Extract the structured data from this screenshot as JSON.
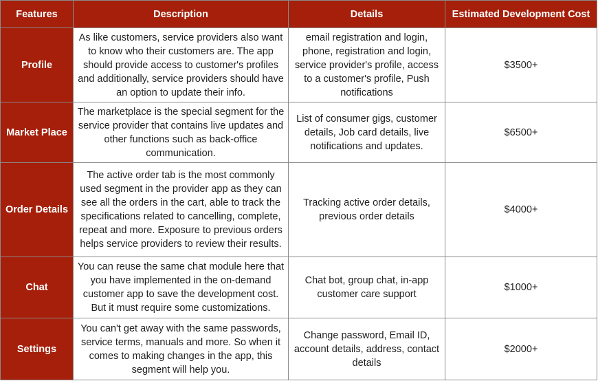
{
  "table": {
    "headers": {
      "features": "Features",
      "description": "Description",
      "details": "Details",
      "cost": "Estimated Development Cost"
    },
    "rows": [
      {
        "feature": "Profile",
        "description": "As like customers, service providers also want to know who their customers are. The app should provide access to customer's profiles and additionally, service providers should have an option to update their info.",
        "details": "email registration and login, phone, registration and login, service provider's profile, access to a customer's profile, Push notifications",
        "cost": "$3500+"
      },
      {
        "feature": "Market Place",
        "description": "The marketplace is the special segment for the service provider that contains live updates and other functions such as back-office communication.",
        "details": "List of consumer gigs, customer details, Job card details, live notifications and updates.",
        "cost": "$6500+"
      },
      {
        "feature": "Order Details",
        "description": "The active order tab is the most commonly used segment in the provider app as they can see all the orders in the cart, able to track the specifications related to cancelling, complete, repeat and more. Exposure to previous orders helps service providers to review their results.",
        "details": "Tracking active order details, previous order details",
        "cost": "$4000+"
      },
      {
        "feature": "Chat",
        "description": "You can reuse the same chat module here that you have implemented in the on-demand customer app to save the development cost. But it must require some customizations.",
        "details": "Chat bot, group chat, in-app customer care support",
        "cost": "$1000+"
      },
      {
        "feature": "Settings",
        "description": "You can't get away with the same passwords, service terms, manuals and more. So when it comes to making changes in the app, this segment will help you.",
        "details": "Change password, Email ID, account details, address, contact details",
        "cost": "$2000+"
      }
    ]
  },
  "colors": {
    "header_bg": "#a51f0a",
    "header_text": "#ffffff",
    "border": "#8a8a8a"
  }
}
